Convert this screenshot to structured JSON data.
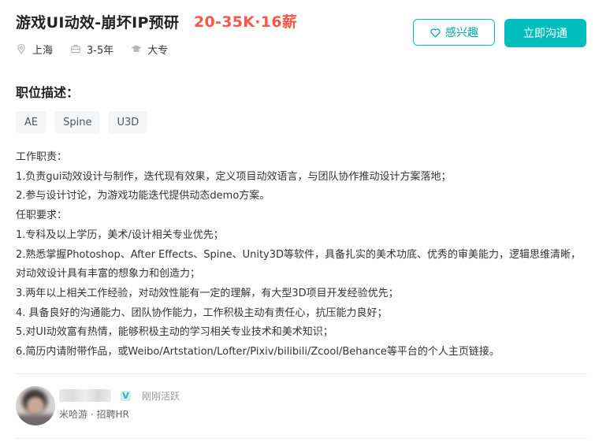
{
  "job": {
    "title": "游戏UI动效-崩坏IP预研",
    "salary": "20-35K·16薪",
    "city": "上海",
    "experience": "3-5年",
    "education": "大专"
  },
  "actions": {
    "interest_label": "感兴趣",
    "chat_label": "立即沟通"
  },
  "section": {
    "title": "职位描述："
  },
  "tags": [
    "AE",
    "Spine",
    "U3D"
  ],
  "description": [
    "工作职责：",
    "1.负责gui动效设计与制作，迭代现有效果，定义项目动效语言，与团队协作推动设计方案落地；",
    "2.参与设计讨论，为游戏功能迭代提供动态demo方案。",
    "任职要求：",
    "1.专科及以上学历，美术/设计相关专业优先；",
    "2.熟悉掌握Photoshop、After Effects、Spine、Unity3D等软件，具备扎实的美术功底、优秀的审美能力，逻辑思维清晰，对动效设计具有丰富的想象力和创造力；",
    "3.两年以上相关工作经验，对动效性能有一定的理解，有大型3D项目开发经验优先；",
    "4. 具备良好的沟通能力、团队协作能力，工作积极主动有责任心，抗压能力良好；",
    "5.对UI动效富有热情，能够积极主动的学习相关专业技术和美术知识；",
    "6.简历内请附带作品，或Weibo/Artstation/Lofter/Pixiv/bilibili/Zcool/Behance等平台的个人主页链接。"
  ],
  "recruiter": {
    "verified_badge": "V",
    "status": "刚刚活跃",
    "company_role": "米哈游 · 招聘HR"
  },
  "colors": {
    "accent": "#00bebd",
    "salary": "#fe574a"
  }
}
